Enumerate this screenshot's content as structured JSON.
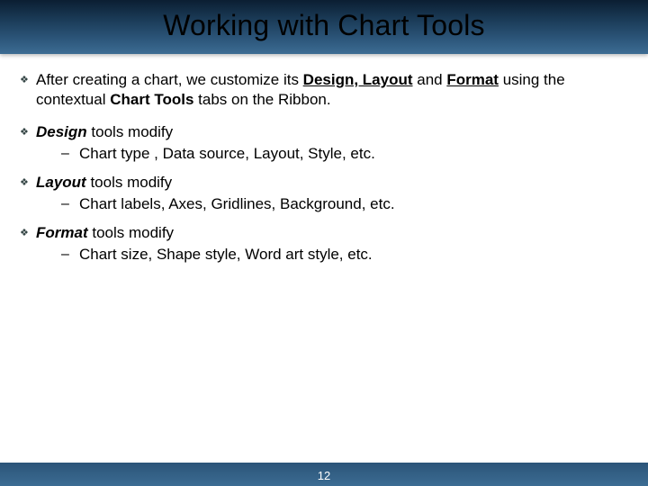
{
  "title": "Working with Chart Tools",
  "bullets": {
    "b0": {
      "pre": "After creating a chart, we customize its ",
      "s1": "Design, Layout",
      "mid1": " and ",
      "s2": "Format",
      "mid2": " using the contextual ",
      "s3": "Chart Tools",
      "post": " tabs on the Ribbon."
    },
    "b1": {
      "lead": "Design",
      "rest": "  tools modify",
      "sub": "Chart type , Data source,  Layout, Style, etc."
    },
    "b2": {
      "lead": "Layout",
      "rest": "  tools modify",
      "sub": "Chart labels, Axes, Gridlines, Background, etc."
    },
    "b3": {
      "lead": "Format",
      "rest": "  tools modify",
      "sub": "Chart size, Shape style, Word art style, etc."
    }
  },
  "icons": {
    "diamond": "❖",
    "dash": "–"
  },
  "page_number": "12"
}
